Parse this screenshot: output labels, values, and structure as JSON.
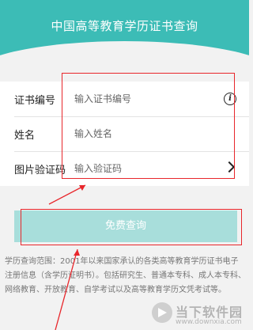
{
  "header": {
    "title": "中国高等教育学历证书查询"
  },
  "form": {
    "cert_number": {
      "label": "证书编号",
      "placeholder": "输入证书编号",
      "value": ""
    },
    "name": {
      "label": "姓名",
      "placeholder": "输入姓名",
      "value": ""
    },
    "captcha": {
      "label": "图片验证码",
      "placeholder": "输入验证码",
      "value": ""
    }
  },
  "query_button": {
    "label": "免费查询"
  },
  "notice": {
    "text": "学历查询范围：2001年以来国家承认的各类高等教育学历证书电子注册信息（含学历证明书）。包括研究生、普通本专科、成人本专科、网络教育、开放教育、自学考试以及高等教育学历文凭考试等。"
  },
  "watermark": {
    "name": "当下软件园",
    "url": "www.downxia.com"
  },
  "colors": {
    "accent": "#3cbcb6",
    "button": "#a8dedb",
    "annotation": "#e8262b"
  },
  "icons": {
    "info": "info-icon",
    "chevron": "chevron-right-icon"
  }
}
